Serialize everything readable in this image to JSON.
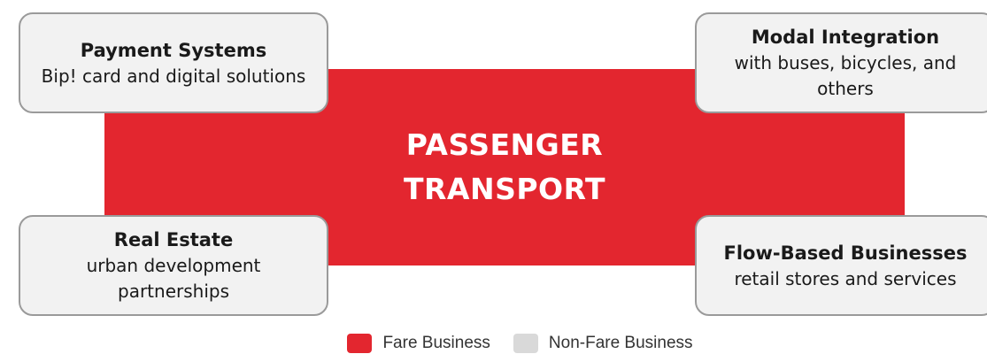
{
  "center": {
    "line1": "PASSENGER",
    "line2": "TRANSPORT"
  },
  "boxes": {
    "top_left": {
      "title": "Payment Systems",
      "desc": "Bip! card and digital solutions"
    },
    "top_right": {
      "title": "Modal Integration",
      "desc": "with buses, bicycles, and others"
    },
    "bottom_left": {
      "title": "Real Estate",
      "desc": "urban development partnerships"
    },
    "bottom_right": {
      "title": "Flow-Based Businesses",
      "desc": "retail stores and services"
    }
  },
  "legend": {
    "fare": {
      "label": "Fare Business",
      "color": "#e3262f"
    },
    "non_fare": {
      "label": "Non-Fare Business",
      "color": "#d9d9d9"
    }
  }
}
